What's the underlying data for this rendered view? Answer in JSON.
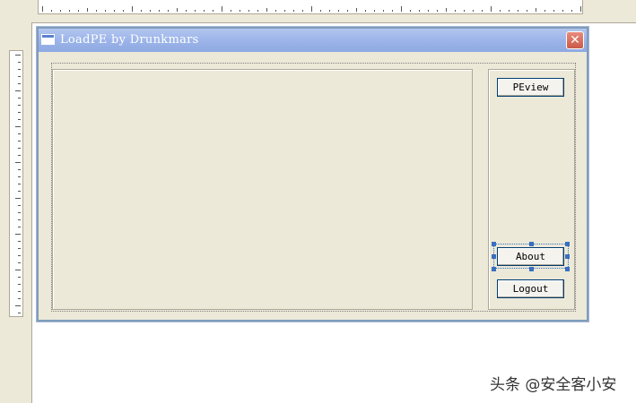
{
  "dialog": {
    "title": "LoadPE by Drunkmars",
    "close_symbol": "✕"
  },
  "buttons": {
    "peview": "PEview",
    "about": "About",
    "logout": "Logout"
  },
  "watermark": "头条 @安全客小安",
  "colors": {
    "titlebar": "#9eb6ea",
    "dialog_face": "#ece9d8",
    "selection": "#3a6fc0",
    "close_button": "#c95b48"
  }
}
